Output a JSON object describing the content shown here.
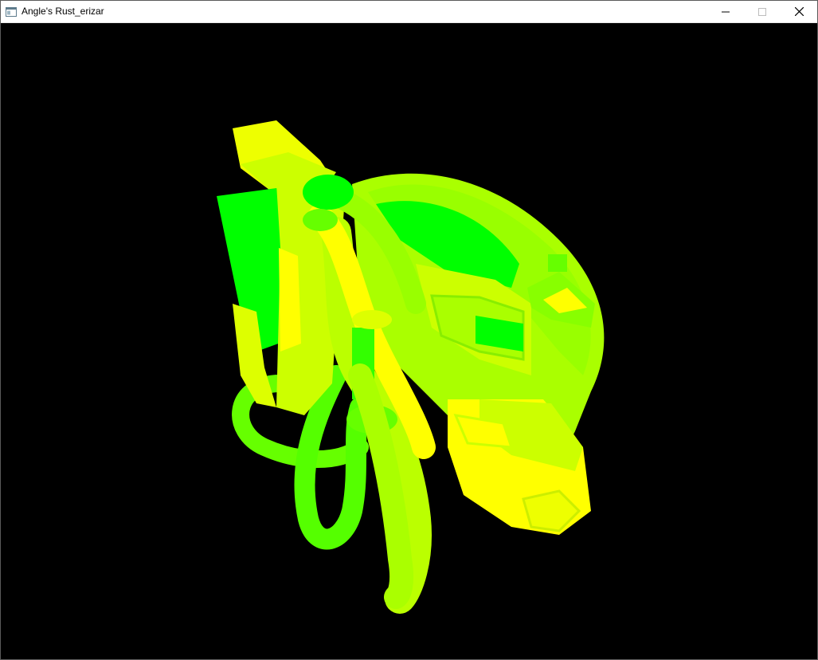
{
  "window": {
    "title": "Angle's Rust_erizar",
    "controls": {
      "minimize_icon": "minimize-icon",
      "maximize_icon": "maximize-icon",
      "close_icon": "close-icon"
    }
  },
  "viewport": {
    "background": "#000000",
    "palette": {
      "green": "#00ff00",
      "lime": "#7fff00",
      "yellow_green": "#c8ff00",
      "yellow": "#ffff00"
    }
  }
}
